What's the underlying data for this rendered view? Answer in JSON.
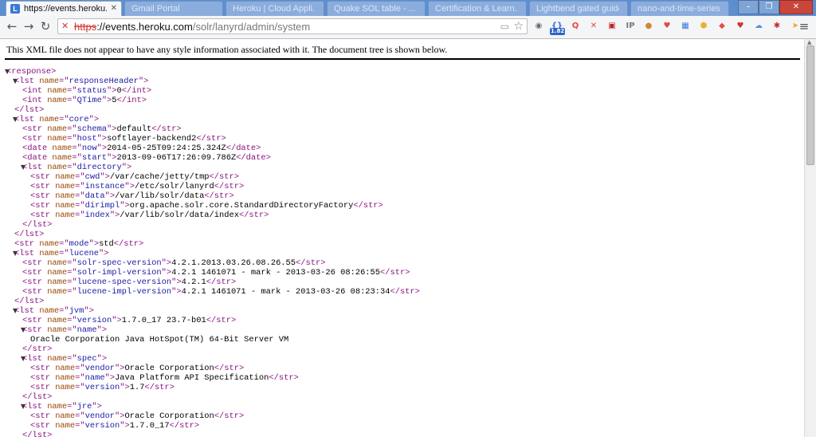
{
  "browser": {
    "active_tab": {
      "title": "https://events.heroku.com",
      "favicon_letter": "L"
    },
    "inactive_tabs": [
      "Gmail Portal",
      "Heroku | Cloud Appli...",
      "Quake SOL table - ...",
      "Certification & Learn...",
      "Lightbend gated guides ...",
      "nano-and-time-series ..."
    ],
    "address": {
      "scheme": "https",
      "host": "://events.heroku.com",
      "path": "/solr/lanyrd/admin/system"
    },
    "extension_badge": "1.82",
    "extension_icons": [
      "globe-icon",
      "braces-icon",
      "pocket-icon",
      "close-red-icon",
      "pdf-icon",
      "ip-icon",
      "cookie-icon",
      "pocket2-icon",
      "calendar-icon",
      "honey-icon",
      "shield-icon",
      "location-icon",
      "cloud-icon",
      "puzzle-icon",
      "lightning-icon"
    ]
  },
  "notice": "This XML file does not appear to have any style information associated with it. The document tree is shown below.",
  "xml_lines": [
    {
      "d": 0,
      "a": true,
      "p": [
        [
          "t",
          "<response>"
        ]
      ]
    },
    {
      "d": 1,
      "a": true,
      "p": [
        [
          "t",
          "<lst "
        ],
        [
          "n",
          "name"
        ],
        [
          "t",
          "=\""
        ],
        [
          "v",
          "responseHeader"
        ],
        [
          "t",
          "\">"
        ]
      ]
    },
    {
      "d": 2,
      "p": [
        [
          "t",
          "<int "
        ],
        [
          "n",
          "name"
        ],
        [
          "t",
          "=\""
        ],
        [
          "v",
          "status"
        ],
        [
          "t",
          "\">"
        ],
        [
          "x",
          "0"
        ],
        [
          "t",
          "</int>"
        ]
      ]
    },
    {
      "d": 2,
      "p": [
        [
          "t",
          "<int "
        ],
        [
          "n",
          "name"
        ],
        [
          "t",
          "=\""
        ],
        [
          "v",
          "QTime"
        ],
        [
          "t",
          "\">"
        ],
        [
          "x",
          "5"
        ],
        [
          "t",
          "</int>"
        ]
      ]
    },
    {
      "d": 1,
      "p": [
        [
          "t",
          "</lst>"
        ]
      ]
    },
    {
      "d": 1,
      "a": true,
      "p": [
        [
          "t",
          "<lst "
        ],
        [
          "n",
          "name"
        ],
        [
          "t",
          "=\""
        ],
        [
          "v",
          "core"
        ],
        [
          "t",
          "\">"
        ]
      ]
    },
    {
      "d": 2,
      "p": [
        [
          "t",
          "<str "
        ],
        [
          "n",
          "name"
        ],
        [
          "t",
          "=\""
        ],
        [
          "v",
          "schema"
        ],
        [
          "t",
          "\">"
        ],
        [
          "x",
          "default"
        ],
        [
          "t",
          "</str>"
        ]
      ]
    },
    {
      "d": 2,
      "p": [
        [
          "t",
          "<str "
        ],
        [
          "n",
          "name"
        ],
        [
          "t",
          "=\""
        ],
        [
          "v",
          "host"
        ],
        [
          "t",
          "\">"
        ],
        [
          "x",
          "softlayer-backend2"
        ],
        [
          "t",
          "</str>"
        ]
      ]
    },
    {
      "d": 2,
      "p": [
        [
          "t",
          "<date "
        ],
        [
          "n",
          "name"
        ],
        [
          "t",
          "=\""
        ],
        [
          "v",
          "now"
        ],
        [
          "t",
          "\">"
        ],
        [
          "x",
          "2014-05-25T09:24:25.324Z"
        ],
        [
          "t",
          "</date>"
        ]
      ]
    },
    {
      "d": 2,
      "p": [
        [
          "t",
          "<date "
        ],
        [
          "n",
          "name"
        ],
        [
          "t",
          "=\""
        ],
        [
          "v",
          "start"
        ],
        [
          "t",
          "\">"
        ],
        [
          "x",
          "2013-09-06T17:26:09.786Z"
        ],
        [
          "t",
          "</date>"
        ]
      ]
    },
    {
      "d": 2,
      "a": true,
      "p": [
        [
          "t",
          "<lst "
        ],
        [
          "n",
          "name"
        ],
        [
          "t",
          "=\""
        ],
        [
          "v",
          "directory"
        ],
        [
          "t",
          "\">"
        ]
      ]
    },
    {
      "d": 3,
      "p": [
        [
          "t",
          "<str "
        ],
        [
          "n",
          "name"
        ],
        [
          "t",
          "=\""
        ],
        [
          "v",
          "cwd"
        ],
        [
          "t",
          "\">"
        ],
        [
          "x",
          "/var/cache/jetty/tmp"
        ],
        [
          "t",
          "</str>"
        ]
      ]
    },
    {
      "d": 3,
      "p": [
        [
          "t",
          "<str "
        ],
        [
          "n",
          "name"
        ],
        [
          "t",
          "=\""
        ],
        [
          "v",
          "instance"
        ],
        [
          "t",
          "\">"
        ],
        [
          "x",
          "/etc/solr/lanyrd"
        ],
        [
          "t",
          "</str>"
        ]
      ]
    },
    {
      "d": 3,
      "p": [
        [
          "t",
          "<str "
        ],
        [
          "n",
          "name"
        ],
        [
          "t",
          "=\""
        ],
        [
          "v",
          "data"
        ],
        [
          "t",
          "\">"
        ],
        [
          "x",
          "/var/lib/solr/data"
        ],
        [
          "t",
          "</str>"
        ]
      ]
    },
    {
      "d": 3,
      "p": [
        [
          "t",
          "<str "
        ],
        [
          "n",
          "name"
        ],
        [
          "t",
          "=\""
        ],
        [
          "v",
          "dirimpl"
        ],
        [
          "t",
          "\">"
        ],
        [
          "x",
          "org.apache.solr.core.StandardDirectoryFactory"
        ],
        [
          "t",
          "</str>"
        ]
      ]
    },
    {
      "d": 3,
      "p": [
        [
          "t",
          "<str "
        ],
        [
          "n",
          "name"
        ],
        [
          "t",
          "=\""
        ],
        [
          "v",
          "index"
        ],
        [
          "t",
          "\">"
        ],
        [
          "x",
          "/var/lib/solr/data/index"
        ],
        [
          "t",
          "</str>"
        ]
      ]
    },
    {
      "d": 2,
      "p": [
        [
          "t",
          "</lst>"
        ]
      ]
    },
    {
      "d": 1,
      "p": [
        [
          "t",
          "</lst>"
        ]
      ]
    },
    {
      "d": 1,
      "p": [
        [
          "t",
          "<str "
        ],
        [
          "n",
          "name"
        ],
        [
          "t",
          "=\""
        ],
        [
          "v",
          "mode"
        ],
        [
          "t",
          "\">"
        ],
        [
          "x",
          "std"
        ],
        [
          "t",
          "</str>"
        ]
      ]
    },
    {
      "d": 1,
      "a": true,
      "p": [
        [
          "t",
          "<lst "
        ],
        [
          "n",
          "name"
        ],
        [
          "t",
          "=\""
        ],
        [
          "v",
          "lucene"
        ],
        [
          "t",
          "\">"
        ]
      ]
    },
    {
      "d": 2,
      "p": [
        [
          "t",
          "<str "
        ],
        [
          "n",
          "name"
        ],
        [
          "t",
          "=\""
        ],
        [
          "v",
          "solr-spec-version"
        ],
        [
          "t",
          "\">"
        ],
        [
          "x",
          "4.2.1.2013.03.26.08.26.55"
        ],
        [
          "t",
          "</str>"
        ]
      ]
    },
    {
      "d": 2,
      "p": [
        [
          "t",
          "<str "
        ],
        [
          "n",
          "name"
        ],
        [
          "t",
          "=\""
        ],
        [
          "v",
          "solr-impl-version"
        ],
        [
          "t",
          "\">"
        ],
        [
          "x",
          "4.2.1 1461071 - mark - 2013-03-26 08:26:55"
        ],
        [
          "t",
          "</str>"
        ]
      ]
    },
    {
      "d": 2,
      "p": [
        [
          "t",
          "<str "
        ],
        [
          "n",
          "name"
        ],
        [
          "t",
          "=\""
        ],
        [
          "v",
          "lucene-spec-version"
        ],
        [
          "t",
          "\">"
        ],
        [
          "x",
          "4.2.1"
        ],
        [
          "t",
          "</str>"
        ]
      ]
    },
    {
      "d": 2,
      "p": [
        [
          "t",
          "<str "
        ],
        [
          "n",
          "name"
        ],
        [
          "t",
          "=\""
        ],
        [
          "v",
          "lucene-impl-version"
        ],
        [
          "t",
          "\">"
        ],
        [
          "x",
          "4.2.1 1461071 - mark - 2013-03-26 08:23:34"
        ],
        [
          "t",
          "</str>"
        ]
      ]
    },
    {
      "d": 1,
      "p": [
        [
          "t",
          "</lst>"
        ]
      ]
    },
    {
      "d": 1,
      "a": true,
      "p": [
        [
          "t",
          "<lst "
        ],
        [
          "n",
          "name"
        ],
        [
          "t",
          "=\""
        ],
        [
          "v",
          "jvm"
        ],
        [
          "t",
          "\">"
        ]
      ]
    },
    {
      "d": 2,
      "p": [
        [
          "t",
          "<str "
        ],
        [
          "n",
          "name"
        ],
        [
          "t",
          "=\""
        ],
        [
          "v",
          "version"
        ],
        [
          "t",
          "\">"
        ],
        [
          "x",
          "1.7.0_17 23.7-b01"
        ],
        [
          "t",
          "</str>"
        ]
      ]
    },
    {
      "d": 2,
      "a": true,
      "p": [
        [
          "t",
          "<str "
        ],
        [
          "n",
          "name"
        ],
        [
          "t",
          "=\""
        ],
        [
          "v",
          "name"
        ],
        [
          "t",
          "\">"
        ]
      ]
    },
    {
      "d": 3,
      "p": [
        [
          "x",
          "Oracle Corporation Java HotSpot(TM) 64-Bit Server VM"
        ]
      ]
    },
    {
      "d": 2,
      "p": [
        [
          "t",
          "</str>"
        ]
      ]
    },
    {
      "d": 2,
      "a": true,
      "p": [
        [
          "t",
          "<lst "
        ],
        [
          "n",
          "name"
        ],
        [
          "t",
          "=\""
        ],
        [
          "v",
          "spec"
        ],
        [
          "t",
          "\">"
        ]
      ]
    },
    {
      "d": 3,
      "p": [
        [
          "t",
          "<str "
        ],
        [
          "n",
          "name"
        ],
        [
          "t",
          "=\""
        ],
        [
          "v",
          "vendor"
        ],
        [
          "t",
          "\">"
        ],
        [
          "x",
          "Oracle Corporation"
        ],
        [
          "t",
          "</str>"
        ]
      ]
    },
    {
      "d": 3,
      "p": [
        [
          "t",
          "<str "
        ],
        [
          "n",
          "name"
        ],
        [
          "t",
          "=\""
        ],
        [
          "v",
          "name"
        ],
        [
          "t",
          "\">"
        ],
        [
          "x",
          "Java Platform API Specification"
        ],
        [
          "t",
          "</str>"
        ]
      ]
    },
    {
      "d": 3,
      "p": [
        [
          "t",
          "<str "
        ],
        [
          "n",
          "name"
        ],
        [
          "t",
          "=\""
        ],
        [
          "v",
          "version"
        ],
        [
          "t",
          "\">"
        ],
        [
          "x",
          "1.7"
        ],
        [
          "t",
          "</str>"
        ]
      ]
    },
    {
      "d": 2,
      "p": [
        [
          "t",
          "</lst>"
        ]
      ]
    },
    {
      "d": 2,
      "a": true,
      "p": [
        [
          "t",
          "<lst "
        ],
        [
          "n",
          "name"
        ],
        [
          "t",
          "=\""
        ],
        [
          "v",
          "jre"
        ],
        [
          "t",
          "\">"
        ]
      ]
    },
    {
      "d": 3,
      "p": [
        [
          "t",
          "<str "
        ],
        [
          "n",
          "name"
        ],
        [
          "t",
          "=\""
        ],
        [
          "v",
          "vendor"
        ],
        [
          "t",
          "\">"
        ],
        [
          "x",
          "Oracle Corporation"
        ],
        [
          "t",
          "</str>"
        ]
      ]
    },
    {
      "d": 3,
      "p": [
        [
          "t",
          "<str "
        ],
        [
          "n",
          "name"
        ],
        [
          "t",
          "=\""
        ],
        [
          "v",
          "version"
        ],
        [
          "t",
          "\">"
        ],
        [
          "x",
          "1.7.0_17"
        ],
        [
          "t",
          "</str>"
        ]
      ]
    },
    {
      "d": 2,
      "p": [
        [
          "t",
          "</lst>"
        ]
      ]
    }
  ],
  "colors": {
    "tag": "#881280",
    "attr_name": "#994500",
    "attr_value": "#1a1aa6",
    "tabbar": "#5d8fcf"
  }
}
